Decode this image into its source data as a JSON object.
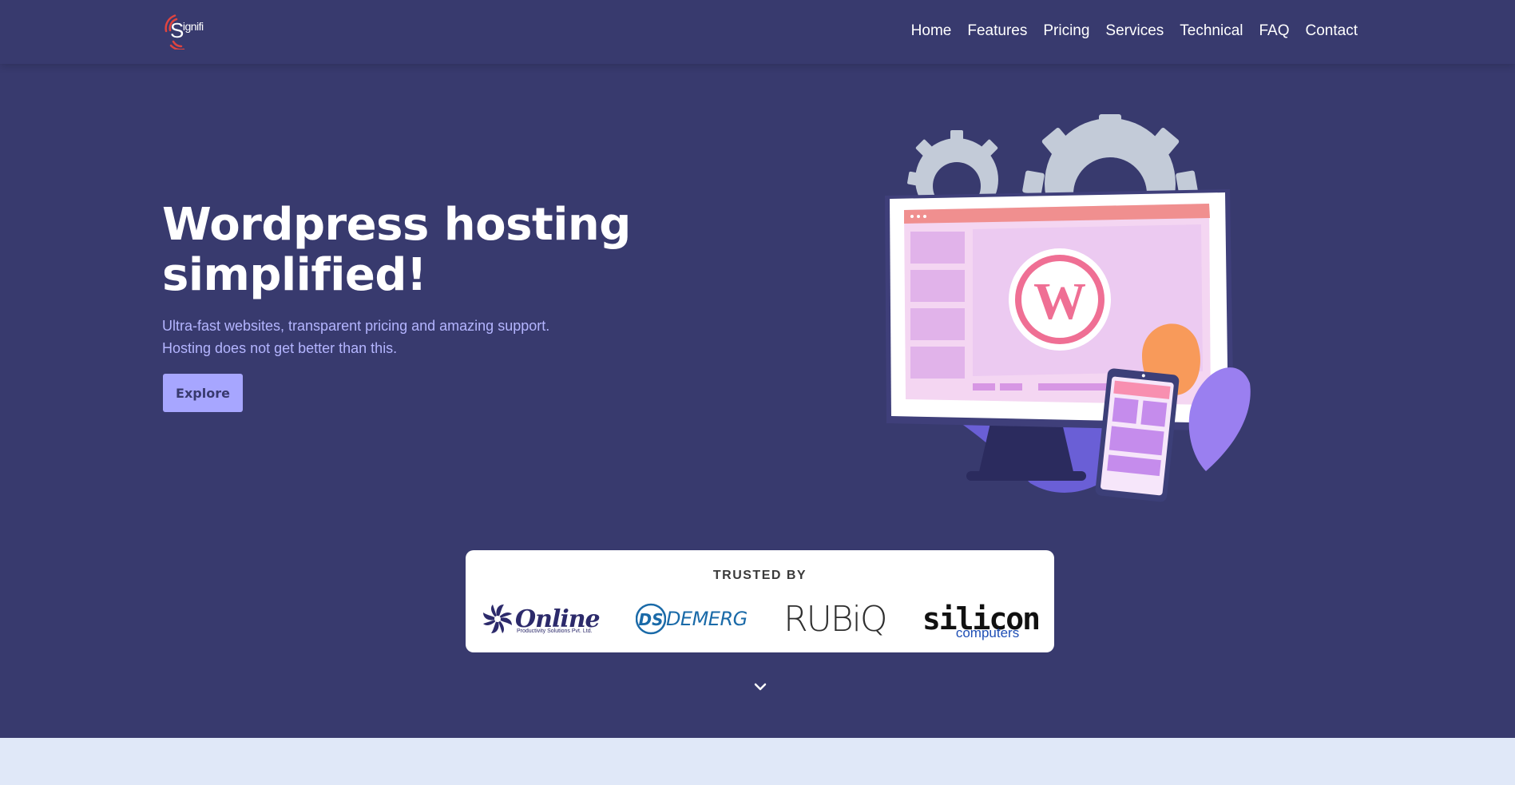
{
  "brand": {
    "logo_text_main": "S",
    "logo_text_small": "ignifi"
  },
  "nav": {
    "items": [
      {
        "label": "Home"
      },
      {
        "label": "Features"
      },
      {
        "label": "Pricing"
      },
      {
        "label": "Services"
      },
      {
        "label": "Technical"
      },
      {
        "label": "FAQ"
      },
      {
        "label": "Contact"
      }
    ]
  },
  "hero": {
    "title_line1": "Wordpress hosting",
    "title_line2": "simplified!",
    "subtitle_line1": "Ultra-fast websites, transparent pricing and amazing support.",
    "subtitle_line2": "Hosting does not get better than this.",
    "cta_label": "Explore"
  },
  "trusted": {
    "label": "TRUSTED BY",
    "logos": [
      {
        "name": "Online",
        "tagline": "Productivity Solutions Pvt. Ltd."
      },
      {
        "name": "DEMERG",
        "initials": "DS"
      },
      {
        "name": "RUBiQ"
      },
      {
        "name": "silicon",
        "sub": "computers"
      }
    ]
  },
  "colors": {
    "background": "#383a6e",
    "accent": "#a7a6ff",
    "subtitle": "#b4b5ff",
    "next_section": "#e0e8f8"
  },
  "icons": {
    "scroll": "chevron-down-icon"
  }
}
